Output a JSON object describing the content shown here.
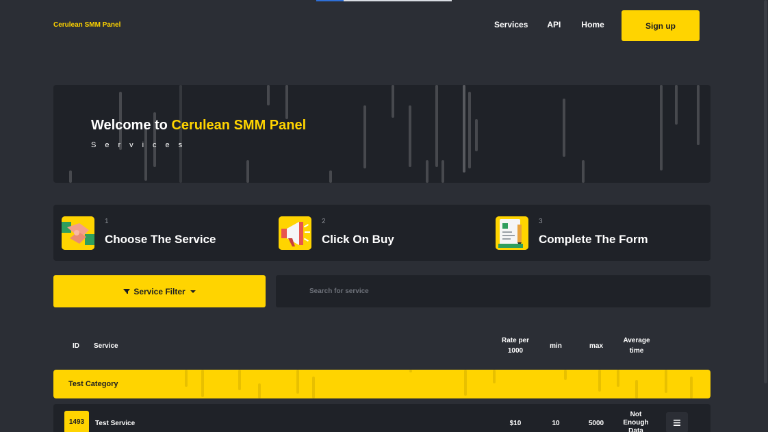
{
  "header": {
    "brand": "Cerulean SMM Panel",
    "nav": [
      "Services",
      "API",
      "Home"
    ],
    "signup_label": "Sign up"
  },
  "hero": {
    "welcome": "Welcome to",
    "brand_accent": "Cerulean SMM Panel",
    "subtitle": "Services"
  },
  "steps": [
    {
      "num": "1",
      "label": "Choose The Service",
      "icon": "handshake-icon"
    },
    {
      "num": "2",
      "label": "Click On Buy",
      "icon": "megaphone-icon"
    },
    {
      "num": "3",
      "label": "Complete The Form",
      "icon": "form-icon"
    }
  ],
  "filter": {
    "label": "Service Filter"
  },
  "search": {
    "placeholder": "Search for service"
  },
  "table": {
    "headers": {
      "id": "ID",
      "service": "Service",
      "rate": "Rate per 1000",
      "min": "min",
      "max": "max",
      "avg": "Average time"
    },
    "category": "Test Category",
    "rows": [
      {
        "id": "1493",
        "service": "Test Service",
        "rate": "$10",
        "min": "10",
        "max": "5000",
        "avg": "Not Enough Data"
      }
    ]
  },
  "colors": {
    "accent": "#ffd400",
    "background": "#2b2e35",
    "card": "#1f2228"
  }
}
